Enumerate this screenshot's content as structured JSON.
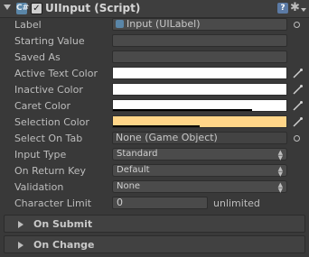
{
  "component": {
    "title": "UIInput (Script)",
    "enabled": true,
    "script_icon": "C#",
    "help_icon": "?"
  },
  "fields": {
    "label": {
      "name": "Label",
      "value": "Input (UILabel)"
    },
    "starting_value": {
      "name": "Starting Value",
      "value": ""
    },
    "saved_as": {
      "name": "Saved As",
      "value": ""
    },
    "active_text_color": {
      "name": "Active Text Color",
      "color": "#ffffff"
    },
    "inactive_color": {
      "name": "Inactive Color",
      "color": "#ffffff"
    },
    "caret_color": {
      "name": "Caret Color",
      "color": "#ffffff",
      "alpha": 0.8
    },
    "selection_color": {
      "name": "Selection Color",
      "color": "#ffd588",
      "alpha": 0.5
    },
    "select_on_tab": {
      "name": "Select On Tab",
      "value": "None (Game Object)"
    },
    "input_type": {
      "name": "Input Type",
      "value": "Standard"
    },
    "on_return_key": {
      "name": "On Return Key",
      "value": "Default"
    },
    "validation": {
      "name": "Validation",
      "value": "None"
    },
    "character_limit": {
      "name": "Character Limit",
      "value": "0",
      "suffix": "unlimited"
    }
  },
  "events": {
    "on_submit": "On Submit",
    "on_change": "On Change"
  }
}
